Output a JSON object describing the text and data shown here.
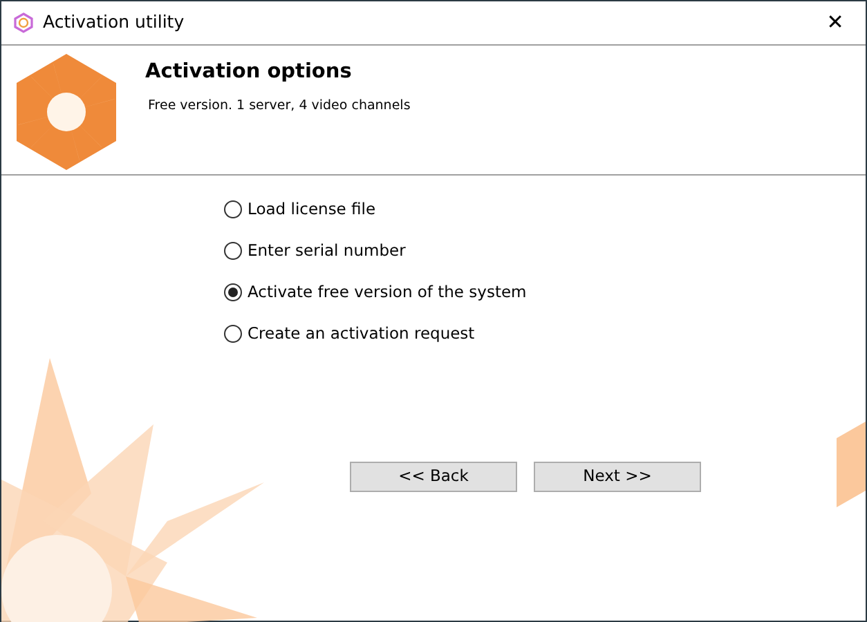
{
  "window": {
    "title": "Activation utility",
    "close": "✕"
  },
  "header": {
    "title": "Activation options",
    "subtitle": "Free version. 1 server, 4 video channels"
  },
  "options": [
    {
      "label": "Load license file",
      "selected": false
    },
    {
      "label": "Enter serial number",
      "selected": false
    },
    {
      "label": "Activate free version of the system",
      "selected": true
    },
    {
      "label": "Create an activation request",
      "selected": false
    }
  ],
  "buttons": [
    "<< Back",
    "Next >>"
  ]
}
